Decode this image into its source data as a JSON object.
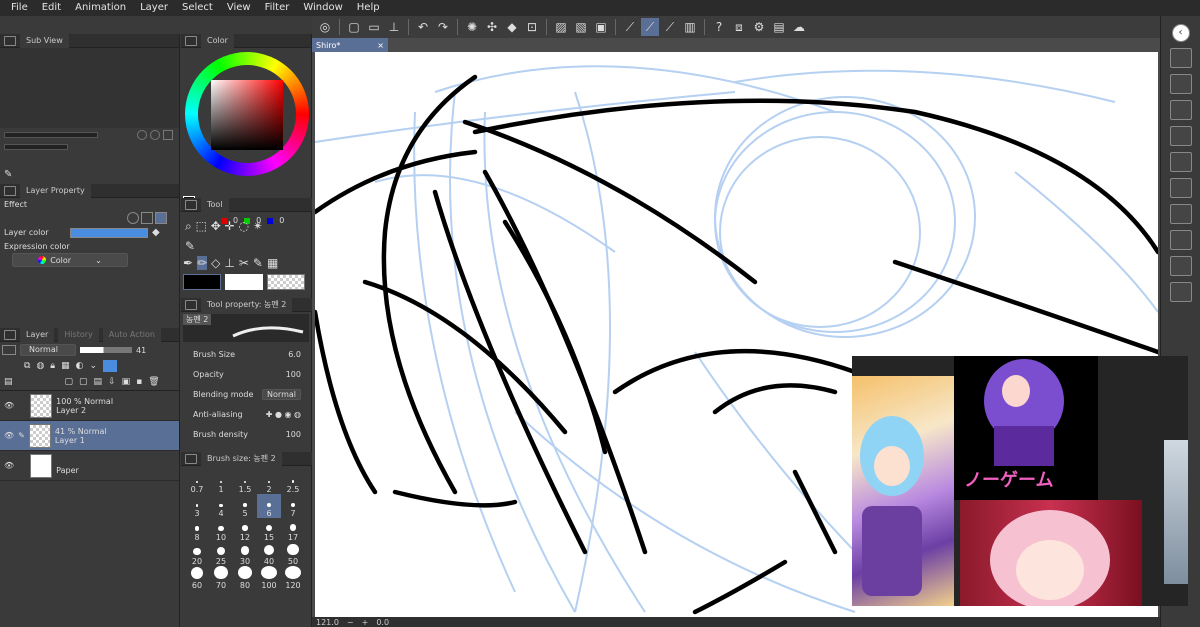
{
  "menu": [
    "File",
    "Edit",
    "Animation",
    "Layer",
    "Select",
    "View",
    "Filter",
    "Window",
    "Help"
  ],
  "document_tab": {
    "title": "Shiro*",
    "close": "×"
  },
  "subview": {
    "title": "Sub View"
  },
  "color_panel": {
    "title": "Color",
    "rgb": [
      "0",
      "0",
      "0"
    ],
    "accent": "#5a6f95"
  },
  "layer_property": {
    "title": "Layer Property",
    "effect_label": "Effect",
    "layer_color_label": "Layer color",
    "layer_color": "#4a8de0",
    "expression_color_label": "Expression color",
    "expression_value": "Color"
  },
  "layer_panel": {
    "tabs": [
      "Layer",
      "History",
      "Auto Action"
    ],
    "blend_mode": "Normal",
    "opacity": "41",
    "layers": [
      {
        "opacity_mode": "100 % Normal",
        "name": "Layer 2",
        "selected": false
      },
      {
        "opacity_mode": "41 % Normal",
        "name": "Layer 1",
        "selected": true
      },
      {
        "opacity_mode": "",
        "name": "Paper",
        "selected": false
      }
    ]
  },
  "tool_panel": {
    "title": "Tool"
  },
  "tool_property": {
    "title": "Tool property: 농펜 2",
    "preset_label": "농펜 2",
    "rows": [
      {
        "label": "Brush Size",
        "value": "6.0"
      },
      {
        "label": "Opacity",
        "value": "100"
      },
      {
        "label": "Blending mode",
        "value": "Normal"
      },
      {
        "label": "Anti-aliasing",
        "value": ""
      },
      {
        "label": "Brush density",
        "value": "100"
      }
    ]
  },
  "brush_size": {
    "title": "Brush size: 농펜 2",
    "sizes": [
      "0.7",
      "1",
      "1.5",
      "2",
      "2.5",
      "3",
      "4",
      "5",
      "6",
      "7",
      "8",
      "10",
      "12",
      "15",
      "17",
      "20",
      "25",
      "30",
      "40",
      "50",
      "60",
      "70",
      "80",
      "100",
      "120"
    ],
    "selected": "6"
  },
  "status": {
    "zoom": "121.0",
    "angle": "0.0"
  }
}
